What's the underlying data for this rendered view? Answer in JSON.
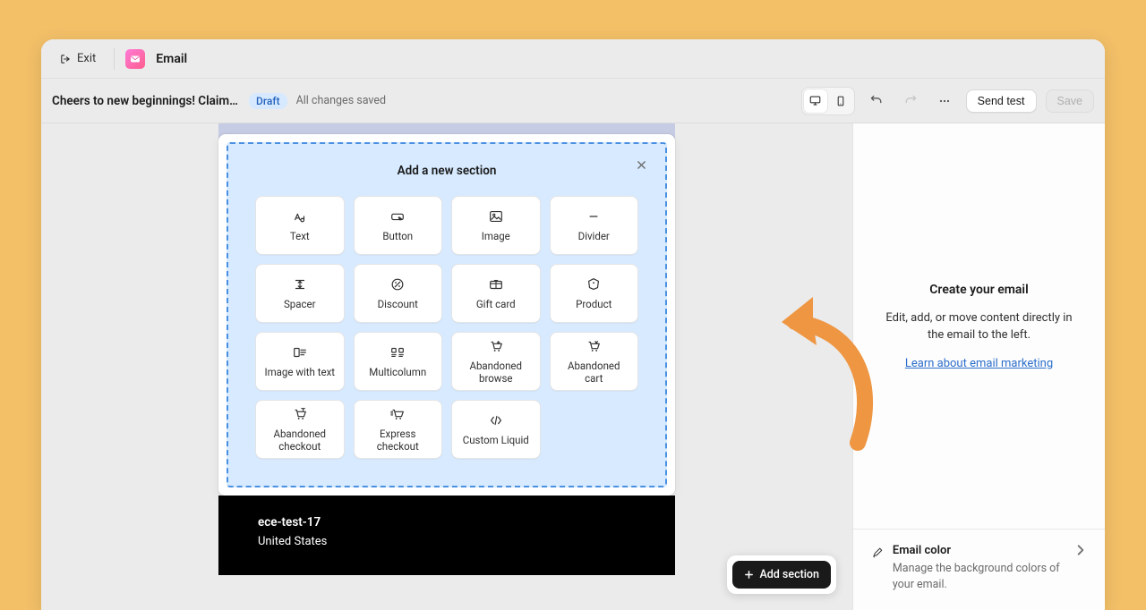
{
  "topbar": {
    "exit_label": "Exit",
    "app_name": "Email"
  },
  "subheader": {
    "subject": "Cheers to new beginnings! Claim yo...",
    "draft_label": "Draft",
    "save_status": "All changes saved",
    "send_test_label": "Send test",
    "save_label": "Save"
  },
  "add_panel": {
    "title": "Add a new section",
    "tiles": [
      {
        "id": "text",
        "label": "Text"
      },
      {
        "id": "button",
        "label": "Button"
      },
      {
        "id": "image",
        "label": "Image"
      },
      {
        "id": "divider",
        "label": "Divider"
      },
      {
        "id": "spacer",
        "label": "Spacer"
      },
      {
        "id": "discount",
        "label": "Discount"
      },
      {
        "id": "giftcard",
        "label": "Gift card"
      },
      {
        "id": "product",
        "label": "Product"
      },
      {
        "id": "imagewithtext",
        "label": "Image with text"
      },
      {
        "id": "multicolumn",
        "label": "Multicolumn"
      },
      {
        "id": "abandonedbrowse",
        "label": "Abandoned\nbrowse"
      },
      {
        "id": "abandonedcart",
        "label": "Abandoned\ncart"
      },
      {
        "id": "abandonedcheckout",
        "label": "Abandoned\ncheckout"
      },
      {
        "id": "expresscheckout",
        "label": "Express\ncheckout"
      },
      {
        "id": "customliquid",
        "label": "Custom Liquid"
      }
    ]
  },
  "email_footer": {
    "name": "ece-test-17",
    "address": "United States"
  },
  "right_panel": {
    "title": "Create your email",
    "text": "Edit, add, or move content directly in the email to the left.",
    "link": "Learn about email marketing",
    "color_row": {
      "title": "Email color",
      "desc": "Manage the background colors of your email."
    }
  },
  "fab": {
    "label": "Add section"
  },
  "colors": {
    "accent_orange": "#ee9642"
  }
}
